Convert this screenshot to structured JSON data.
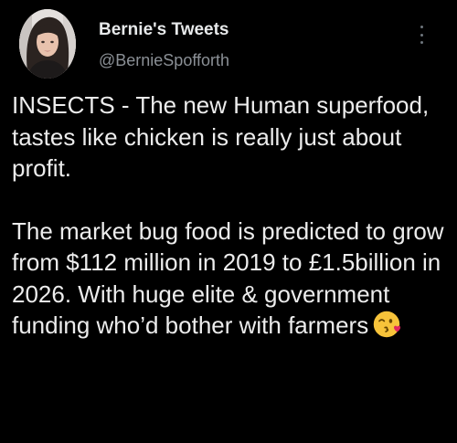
{
  "author": {
    "display_name": "Bernie's Tweets",
    "handle": "@BernieSpofforth",
    "avatar_icon": "profile-photo"
  },
  "menu": {
    "icon": "more-options-icon"
  },
  "tweet": {
    "paragraph_1": "INSECTS - The new Human superfood, tastes like chicken is really just about profit.",
    "paragraph_2": "The market bug food is predicted to grow from $112 million in 2019 to £1.5billion in 2026. With huge elite & government funding who’d bother with farmers",
    "emoji_icon": "face-blowing-kiss-emoji"
  },
  "colors": {
    "background": "#000000",
    "text_primary": "#e7e9ea",
    "text_secondary": "#8b9096",
    "emoji_yellow": "#f7c33a",
    "emoji_heart": "#e0245e"
  }
}
